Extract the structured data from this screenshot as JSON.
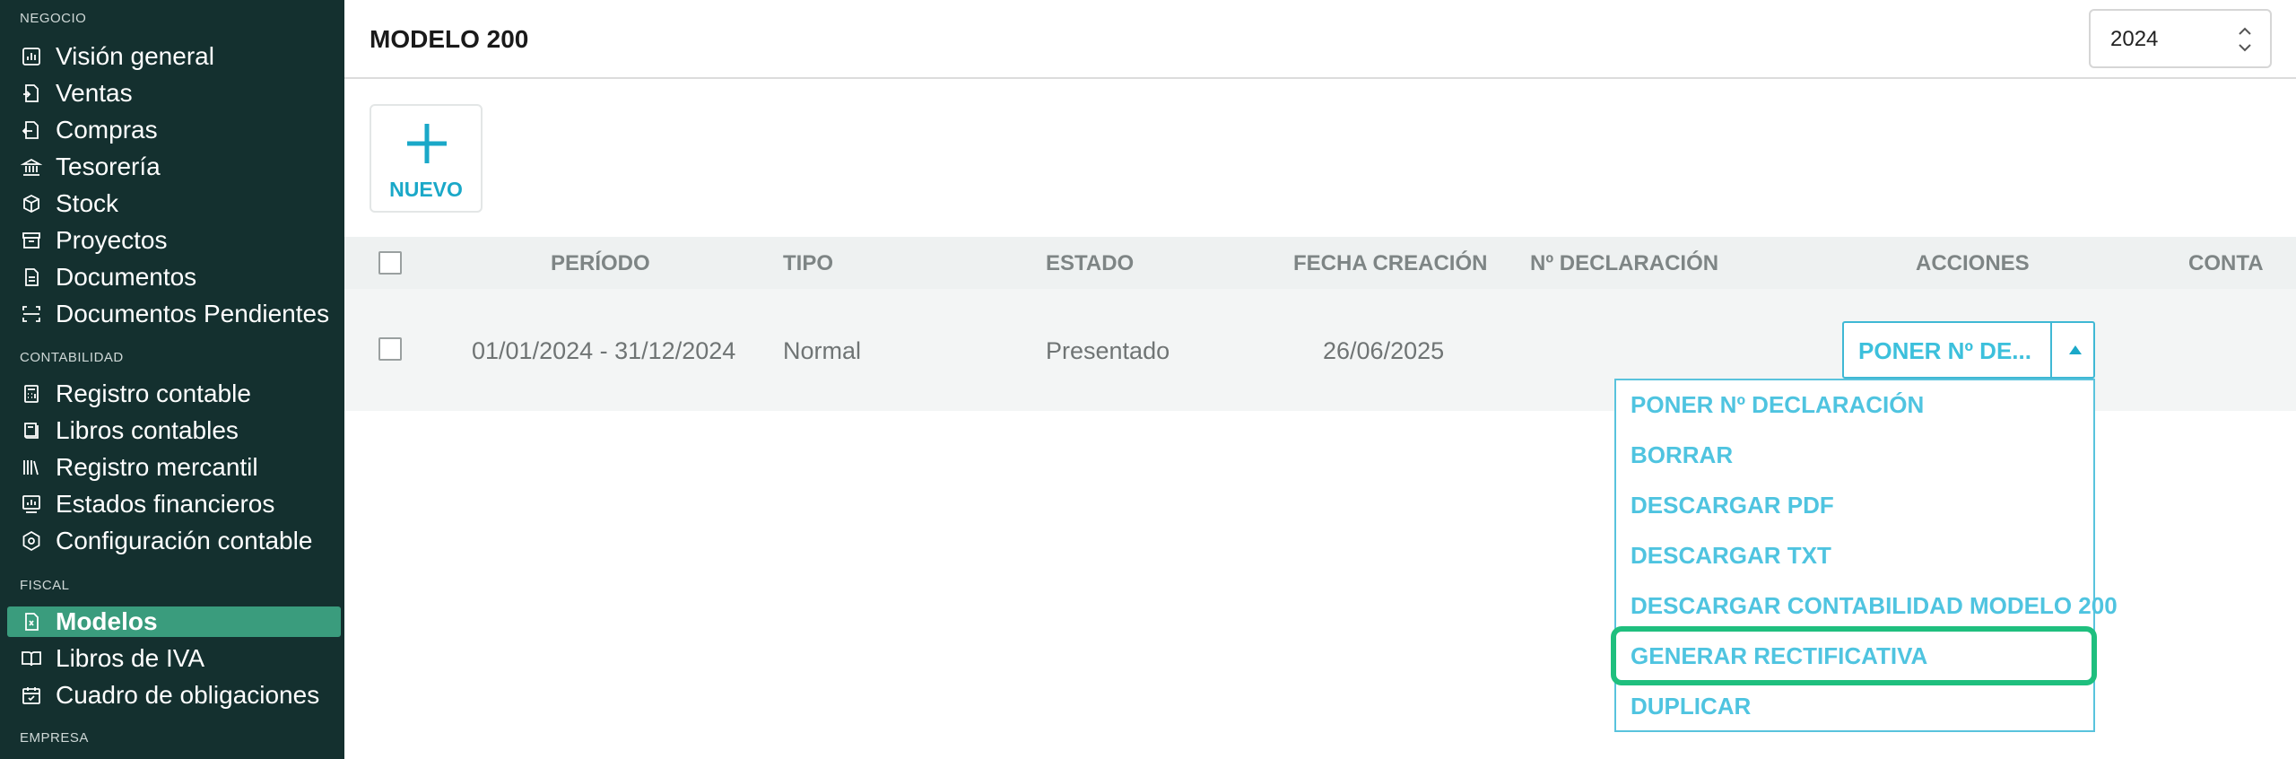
{
  "sidebar": {
    "sections": {
      "negocio": "NEGOCIO",
      "contabilidad": "CONTABILIDAD",
      "fiscal": "FISCAL",
      "empresa": "EMPRESA"
    },
    "items": [
      {
        "label": "Visión general",
        "icon": "chart-icon"
      },
      {
        "label": "Ventas",
        "icon": "sales-doc-icon"
      },
      {
        "label": "Compras",
        "icon": "purchases-doc-icon"
      },
      {
        "label": "Tesorería",
        "icon": "bank-icon"
      },
      {
        "label": "Stock",
        "icon": "box-icon"
      },
      {
        "label": "Proyectos",
        "icon": "archive-icon"
      },
      {
        "label": "Documentos",
        "icon": "document-icon"
      },
      {
        "label": "Documentos Pendientes",
        "icon": "scan-icon"
      },
      {
        "label": "Registro contable",
        "icon": "calculator-icon"
      },
      {
        "label": "Libros contables",
        "icon": "book-icon"
      },
      {
        "label": "Registro mercantil",
        "icon": "library-icon"
      },
      {
        "label": "Estados financieros",
        "icon": "report-chart-icon"
      },
      {
        "label": "Configuración contable",
        "icon": "settings-hex-icon"
      },
      {
        "label": "Modelos",
        "icon": "tax-form-icon",
        "active": true
      },
      {
        "label": "Libros de IVA",
        "icon": "open-book-icon"
      },
      {
        "label": "Cuadro de obligaciones",
        "icon": "calendar-check-icon"
      }
    ]
  },
  "header": {
    "title": "MODELO 200",
    "year": "2024"
  },
  "new_button": {
    "label": "NUEVO"
  },
  "table": {
    "columns": [
      "PERÍODO",
      "TIPO",
      "ESTADO",
      "FECHA CREACIÓN",
      "Nº DECLARACIÓN",
      "ACCIONES",
      "CONTA"
    ],
    "rows": [
      {
        "periodo": "01/01/2024 - 31/12/2024",
        "tipo": "Normal",
        "estado": "Presentado",
        "fecha": "26/06/2025",
        "declaracion": "",
        "conta": ""
      }
    ]
  },
  "actions": {
    "button_label": "PONER Nº DE...",
    "menu": [
      "PONER Nº DECLARACIÓN",
      "BORRAR",
      "DESCARGAR PDF",
      "DESCARGAR TXT",
      "DESCARGAR CONTABILIDAD MODELO 200",
      "GENERAR RECTIFICATIVA",
      "DUPLICAR"
    ],
    "highlighted_item": "GENERAR RECTIFICATIVA"
  },
  "colors": {
    "sidebar_bg": "#14302f",
    "active_item": "#3a9c7d",
    "accent": "#3cc0dc",
    "highlight": "#1fbf7e"
  }
}
